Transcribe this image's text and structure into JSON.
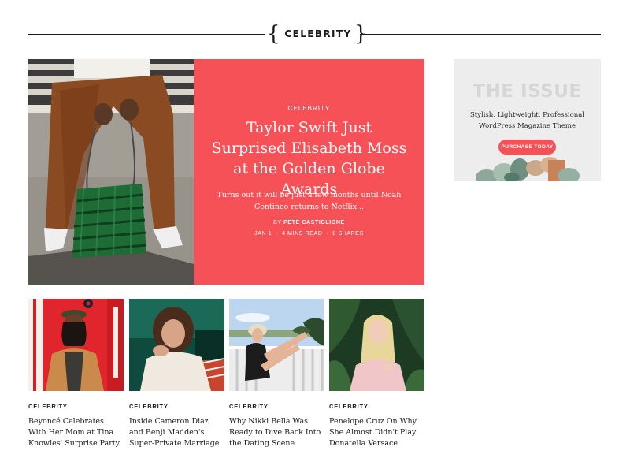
{
  "section": {
    "title": "CELEBRITY"
  },
  "featured": {
    "category": "CELEBRITY",
    "title": "Taylor Swift Just Surprised Elisabeth Moss at the Golden Globe Awards",
    "excerpt": "Turns out it will be just a few months until Noah Centineo returns to Netflix...",
    "by_prefix": "BY",
    "author": "PETE CASTIGLIONE",
    "date": "JAN 1",
    "read_time": "4 MINS READ",
    "shares": "0 SHARES",
    "separator": "·",
    "panel_color": "#f55157"
  },
  "ad": {
    "title": "THE ISSUE",
    "subtitle": "Stylish, Lightweight, Professional WordPress Magazine Theme",
    "button_label": "PURCHASE TODAY"
  },
  "cards": [
    {
      "category": "CELEBRITY",
      "title": "Beyoncé Celebrates With Her Mom at Tina Knowles' Surprise Party"
    },
    {
      "category": "CELEBRITY",
      "title": "Inside Cameron Diaz and Benji Madden's Super-Private Marriage"
    },
    {
      "category": "CELEBRITY",
      "title": "Why Nikki Bella Was Ready to Dive Back Into the Dating Scene"
    },
    {
      "category": "CELEBRITY",
      "title": "Penelope Cruz On Why She Almost Didn't Play Donatella Versace"
    }
  ]
}
